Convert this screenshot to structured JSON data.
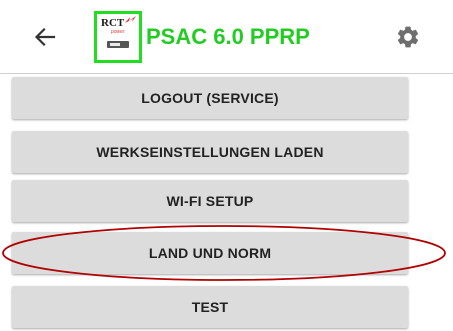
{
  "header": {
    "back_icon": "arrow-left-icon",
    "logo_text": "RCT",
    "logo_subtext": "power",
    "title": "PSAC 6.0 PPRP",
    "title_color": "#22cc22",
    "logo_border_color": "#22dd22",
    "settings_icon": "gear-icon"
  },
  "menu": {
    "buttons": [
      {
        "label": "LOGOUT (SERVICE)"
      },
      {
        "label": "WERKSEINSTELLUNGEN LADEN"
      },
      {
        "label": "WI-FI SETUP"
      },
      {
        "label": "LAND UND NORM",
        "highlighted": true
      },
      {
        "label": "TEST"
      }
    ],
    "button_background": "#dcdcdc"
  },
  "annotation": {
    "type": "ellipse",
    "color": "#b00000",
    "target": "LAND UND NORM"
  }
}
